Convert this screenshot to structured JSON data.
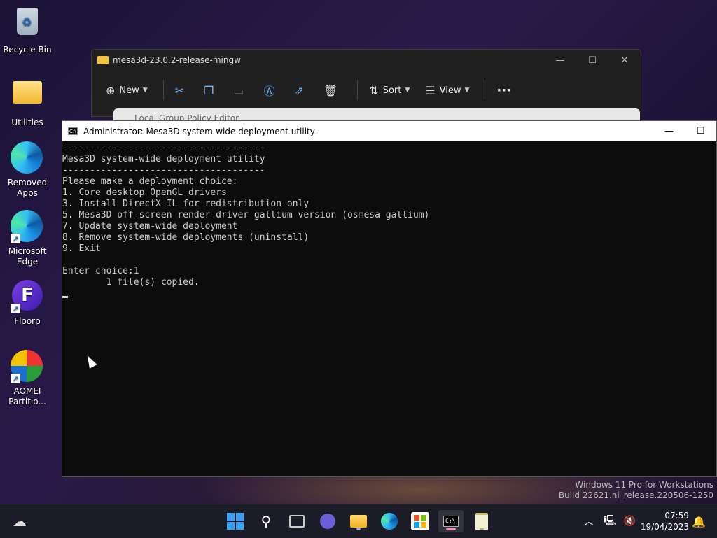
{
  "desktop": {
    "icons": [
      {
        "label": "Recycle Bin"
      },
      {
        "label": "Utilities"
      },
      {
        "label": "Removed Apps"
      },
      {
        "label": "Microsoft Edge"
      },
      {
        "label": "Floorp"
      },
      {
        "label": "AOMEI Partitio..."
      }
    ]
  },
  "explorer": {
    "title": "mesa3d-23.0.2-release-mingw",
    "new_label": "New",
    "sort_label": "Sort",
    "view_label": "View"
  },
  "gpe": {
    "title": "Local Group Policy Editor"
  },
  "console": {
    "title": "Administrator:  Mesa3D system-wide deployment utility",
    "lines": [
      "-------------------------------------",
      "Mesa3D system-wide deployment utility",
      "-------------------------------------",
      "Please make a deployment choice:",
      "1. Core desktop OpenGL drivers",
      "3. Install DirectX IL for redistribution only",
      "5. Mesa3D off-screen render driver gallium version (osmesa gallium)",
      "7. Update system-wide deployment",
      "8. Remove system-wide deployments (uninstall)",
      "9. Exit",
      "",
      "Enter choice:1",
      "        1 file(s) copied."
    ]
  },
  "watermark": {
    "line1": "Windows 11 Pro for Workstations",
    "line2": "Build 22621.ni_release.220506-1250"
  },
  "taskbar": {
    "time": "07:59",
    "date": "19/04/2023"
  },
  "colors": {
    "accent": "#0078d4",
    "console_bg": "#0c0c0c",
    "console_fg": "#cccccc"
  }
}
